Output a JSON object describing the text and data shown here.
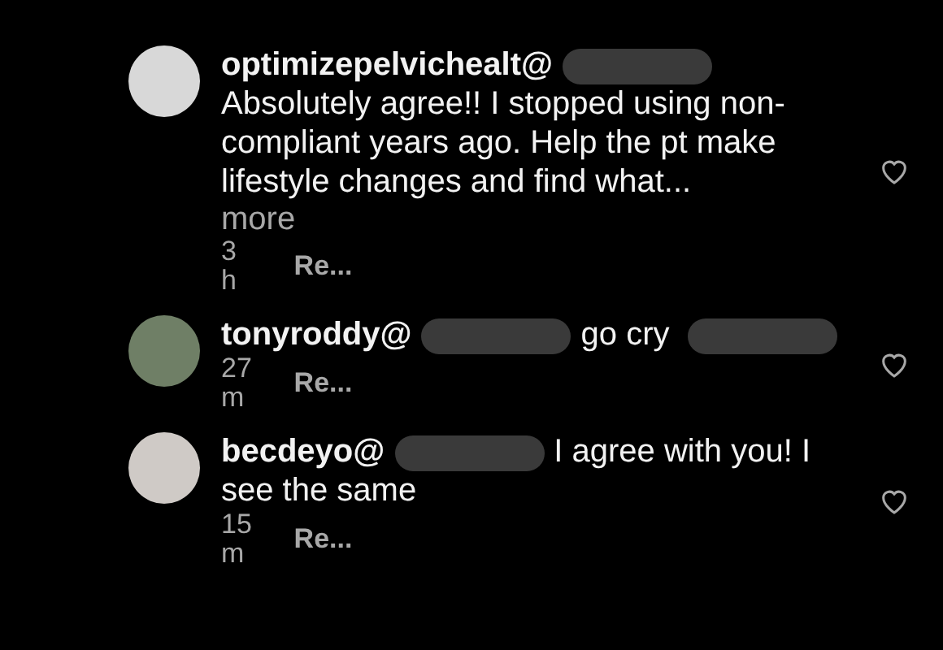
{
  "comments": [
    {
      "username": "optimizepelvichealt@",
      "segments": [
        {
          "kind": "redaction"
        },
        {
          "kind": "break"
        },
        {
          "kind": "text",
          "text": "Absolutely agree!! I stopped using non-compliant years ago. Help the pt make lifestyle changes and find what..."
        }
      ],
      "more": "more",
      "time": "3 h",
      "reply": "Re...",
      "liked": false
    },
    {
      "username": "tonyroddy@",
      "segments": [
        {
          "kind": "redaction"
        },
        {
          "kind": "text",
          "text": "go cry"
        },
        {
          "kind": "redaction"
        }
      ],
      "time": "27 m",
      "reply": "Re...",
      "liked": false
    },
    {
      "username": "becdeyo@",
      "segments": [
        {
          "kind": "redaction"
        },
        {
          "kind": "text",
          "text": "I agree with you! I see the same"
        }
      ],
      "time": "15 m",
      "reply": "Re...",
      "liked": false
    }
  ]
}
